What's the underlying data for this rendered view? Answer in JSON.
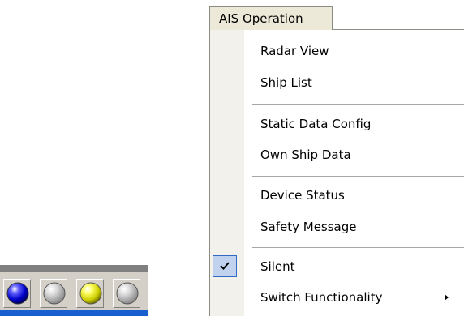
{
  "menu": {
    "title": "AIS Operation",
    "items": [
      {
        "label": "Radar View"
      },
      {
        "label": "Ship List"
      },
      {
        "label": "Static Data Config"
      },
      {
        "label": "Own Ship Data"
      },
      {
        "label": "Device Status"
      },
      {
        "label": "Safety Message"
      },
      {
        "label": "Silent",
        "checked": true
      },
      {
        "label": "Switch Functionality",
        "submenu": true
      }
    ]
  },
  "status_indicators": [
    {
      "icon": "blue-led-icon",
      "color": "#0000cc"
    },
    {
      "icon": "gray-led-icon",
      "color": "#c8c8c8"
    },
    {
      "icon": "yellow-led-icon",
      "color": "#d6d600"
    },
    {
      "icon": "gray-led-icon",
      "color": "#c8c8c8"
    }
  ],
  "colors": {
    "menu_bar": "#ece9d8",
    "gutter": "#f2f1ec",
    "check_highlight": "#c1d2ee",
    "toolbar_strip": "#1a5fd0"
  }
}
